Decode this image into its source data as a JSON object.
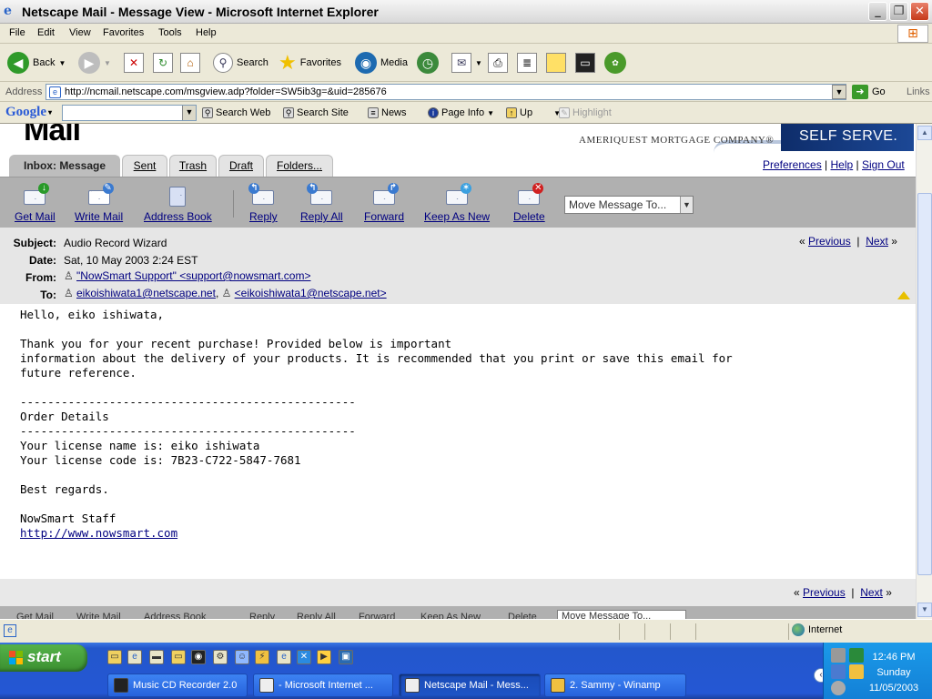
{
  "window": {
    "title": "Netscape Mail - Message View - Microsoft Internet Explorer",
    "min": "_",
    "max": "❐",
    "close": "✕"
  },
  "menu": [
    "File",
    "Edit",
    "View",
    "Favorites",
    "Tools",
    "Help"
  ],
  "toolbar": {
    "back": "Back",
    "search": "Search",
    "favorites": "Favorites",
    "media": "Media"
  },
  "address": {
    "label": "Address",
    "url": "http://ncmail.netscape.com/msgview.adp?folder=SW5ib3g=&uid=285676",
    "go": "Go",
    "links": "Links"
  },
  "googlebar": {
    "logo": "Google",
    "search_web": "Search Web",
    "search_site": "Search Site",
    "news": "News",
    "page_info": "Page Info",
    "up": "Up",
    "highlight": "Highlight"
  },
  "page": {
    "logo": "Mail",
    "ad_company": "AMERIQUEST MORTGAGE COMPANY®",
    "ad_slogan": "SELF SERVE.",
    "tabs": [
      "Inbox: Message",
      "Sent",
      "Trash",
      "Draft",
      "Folders..."
    ],
    "prefs": {
      "preferences": "Preferences",
      "help": "Help",
      "signout": "Sign Out",
      "sep": "|"
    },
    "actions": [
      "Get Mail",
      "Write Mail",
      "Address Book",
      "Reply",
      "Reply All",
      "Forward",
      "Keep As New",
      "Delete"
    ],
    "move_select": "Move Message To...",
    "message": {
      "subject_label": "Subject:",
      "subject": "Audio Record Wizard",
      "date_label": "Date:",
      "date": "Sat, 10 May 2003 2:24 EST",
      "from_label": "From:",
      "from": "\"NowSmart Support\" <support@nowsmart.com>",
      "to_label": "To:",
      "to1": "eikoishiwata1@netscape.net",
      "to_sep": ",",
      "to2": "<eikoishiwata1@netscape.net>",
      "body": "Hello, eiko ishiwata,\n\nThank you for your recent purchase! Provided below is important\ninformation about the delivery of your products. It is recommended that you print or save this email for\nfuture reference.\n\n-------------------------------------------------\nOrder Details\n-------------------------------------------------\nYour license name is: eiko ishiwata\nYour license code is: 7B23-C722-5847-7681\n\nBest regards.\n\nNowSmart Staff\n",
      "link": "http://www.nowsmart.com"
    },
    "nav": {
      "lq": "«",
      "previous": "Previous",
      "sep": "|",
      "next": "Next",
      "rq": "»"
    }
  },
  "status": {
    "zone": "Internet"
  },
  "taskbar": {
    "start": "start",
    "tasks": [
      "Music CD Recorder 2.0",
      "- Microsoft Internet ...",
      "Netscape Mail - Mess...",
      "2. Sammy - Winamp"
    ],
    "clock_time": "12:46 PM",
    "clock_day": "Sunday",
    "clock_date": "11/05/2003"
  }
}
